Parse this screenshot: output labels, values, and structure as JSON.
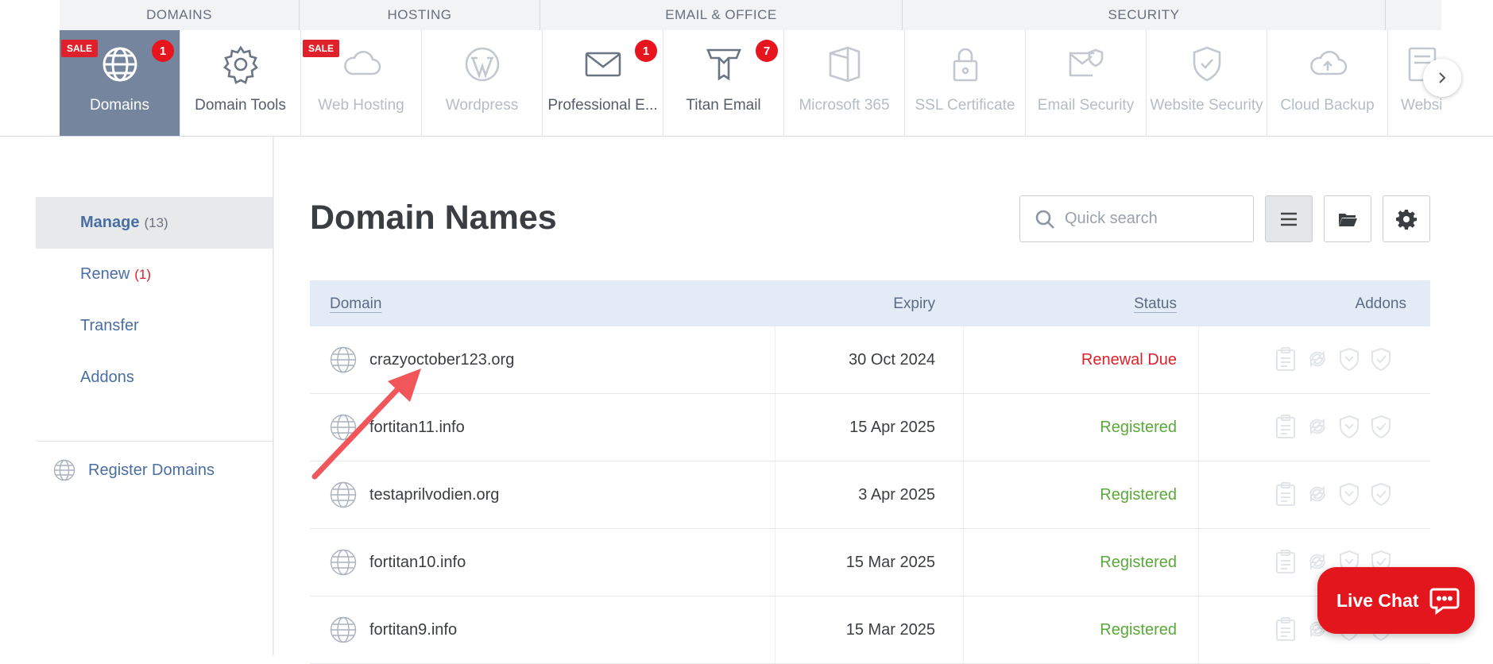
{
  "top_nav": {
    "groups": [
      "DOMAINS",
      "HOSTING",
      "EMAIL & OFFICE",
      "SECURITY"
    ],
    "tiles": [
      {
        "label": "Domains",
        "icon": "globe-icon",
        "sale": "SALE",
        "count": "1",
        "state": "active"
      },
      {
        "label": "Domain Tools",
        "icon": "gear-icon",
        "state": "normal"
      },
      {
        "label": "Web Hosting",
        "icon": "cloud-icon",
        "sale": "SALE",
        "state": "dim"
      },
      {
        "label": "Wordpress",
        "icon": "wordpress-icon",
        "state": "dim"
      },
      {
        "label": "Professional E...",
        "icon": "envelope-icon",
        "count": "1",
        "state": "normal"
      },
      {
        "label": "Titan Email",
        "icon": "titan-icon",
        "count": "7",
        "state": "normal"
      },
      {
        "label": "Microsoft 365",
        "icon": "office-icon",
        "state": "dim"
      },
      {
        "label": "SSL Certificate",
        "icon": "lock-icon",
        "state": "dim"
      },
      {
        "label": "Email Security",
        "icon": "email-shield-icon",
        "state": "dim"
      },
      {
        "label": "Website Security",
        "icon": "shield-check-icon",
        "state": "dim"
      },
      {
        "label": "Cloud Backup",
        "icon": "cloud-upload-icon",
        "state": "dim"
      },
      {
        "label": "Website",
        "icon": "document-icon",
        "state": "dim"
      }
    ]
  },
  "sidebar": {
    "items": [
      {
        "label": "Manage",
        "count": "(13)",
        "active": true
      },
      {
        "label": "Renew",
        "count": "(1)",
        "active": false
      },
      {
        "label": "Transfer",
        "count": "",
        "active": false
      },
      {
        "label": "Addons",
        "count": "",
        "active": false
      }
    ],
    "register_label": "Register Domains"
  },
  "main": {
    "title": "Domain Names",
    "search_placeholder": "Quick search"
  },
  "table": {
    "columns": {
      "domain": "Domain",
      "expiry": "Expiry",
      "status": "Status",
      "addons": "Addons"
    },
    "rows": [
      {
        "domain": "crazyoctober123.org",
        "expiry": "30 Oct 2024",
        "status": "Renewal Due"
      },
      {
        "domain": "fortitan11.info",
        "expiry": "15 Apr 2025",
        "status": "Registered"
      },
      {
        "domain": "testaprilvodien.org",
        "expiry": "3 Apr 2025",
        "status": "Registered"
      },
      {
        "domain": "fortitan10.info",
        "expiry": "15 Mar 2025",
        "status": "Registered"
      },
      {
        "domain": "fortitan9.info",
        "expiry": "15 Mar 2025",
        "status": "Registered"
      }
    ]
  },
  "live_chat": {
    "label": "Live Chat"
  },
  "colors": {
    "accent_blue": "#4a6ea2",
    "active_tile": "#75859d",
    "renewal_due": "#e0202a",
    "registered": "#5aa839",
    "live_chat": "#e3151d",
    "annotation_arrow": "#f0565a"
  }
}
